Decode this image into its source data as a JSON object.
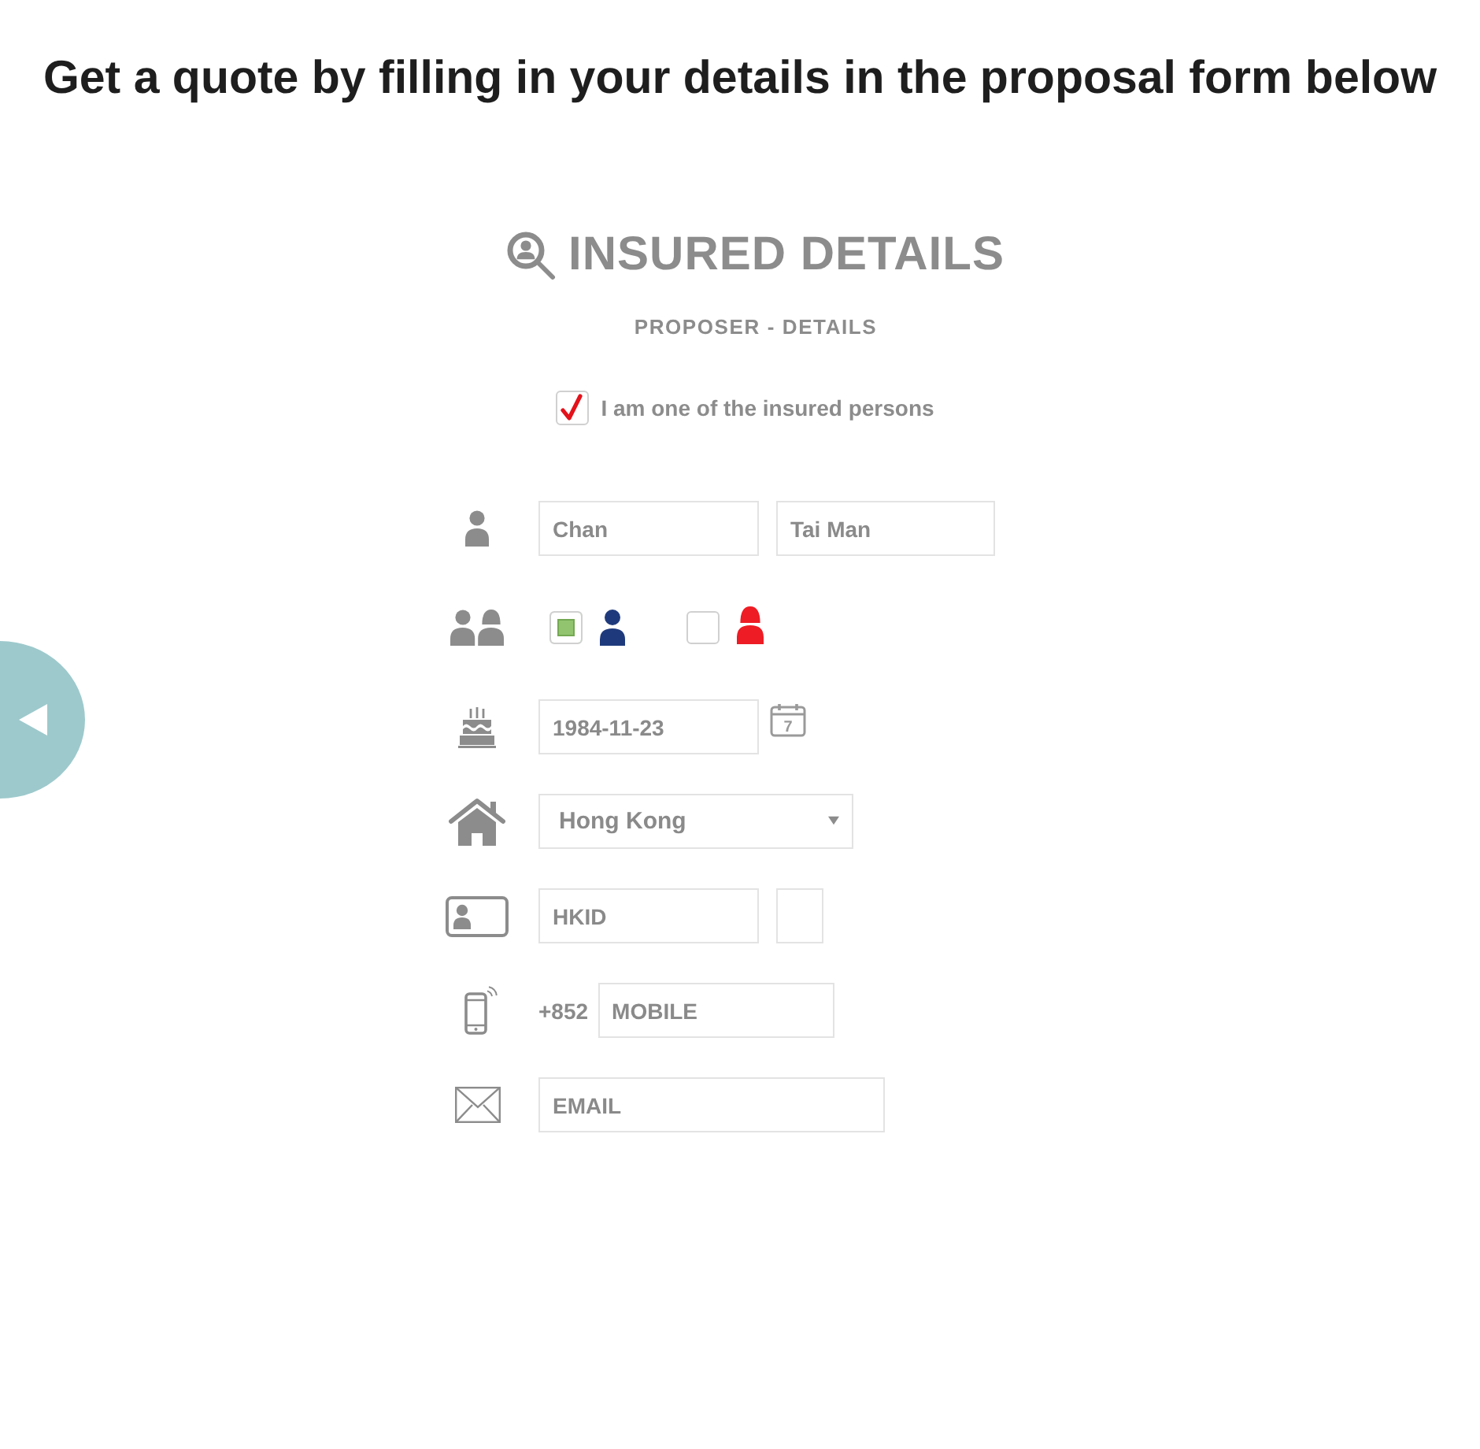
{
  "page_title": "Get a quote by filling in your details in the proposal form below",
  "section": {
    "title": "INSURED DETAILS",
    "subtitle": "PROPOSER - DETAILS"
  },
  "insured_self": {
    "label": "I am one of the insured persons",
    "checked": true
  },
  "name": {
    "surname": "Chan",
    "given_name": "Tai Man"
  },
  "gender": [
    {
      "kind": "male",
      "selected": true,
      "color": "#1f3a7c"
    },
    {
      "kind": "female",
      "selected": false,
      "color": "#ee1c24"
    }
  ],
  "birth_date": {
    "value": "1984-11-23",
    "calendar_day": "7"
  },
  "country": {
    "value": "Hong Kong"
  },
  "id_number": {
    "placeholder": "HKID"
  },
  "mobile": {
    "prefix": "+852",
    "placeholder": "MOBILE"
  },
  "email": {
    "placeholder": "EMAIL"
  }
}
